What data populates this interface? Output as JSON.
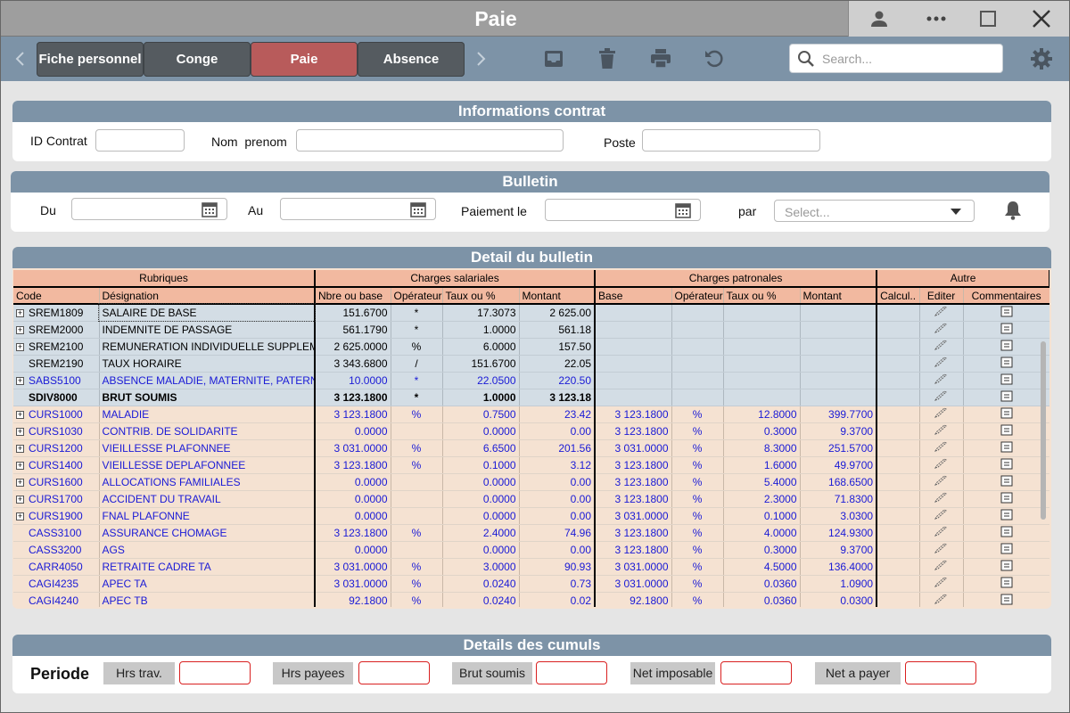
{
  "window": {
    "title": "Paie"
  },
  "tabs": [
    {
      "label": "Fiche personnel",
      "active": false
    },
    {
      "label": "Conge",
      "active": false
    },
    {
      "label": "Paie",
      "active": true
    },
    {
      "label": "Absence",
      "active": false
    }
  ],
  "search": {
    "placeholder": "Search..."
  },
  "contrat": {
    "title": "Informations contrat",
    "id_label": "ID Contrat",
    "nom_label": "Nom  prenom",
    "poste_label": "Poste"
  },
  "bulletin": {
    "title": "Bulletin",
    "du_label": "Du",
    "au_label": "Au",
    "paiement_label": "Paiement le",
    "par_label": "par",
    "par_placeholder": "Select..."
  },
  "detail": {
    "title": "Detail du bulletin",
    "groups": [
      "Rubriques",
      "Charges salariales",
      "Charges patronales",
      "Autre"
    ],
    "columns": [
      "Code",
      "Désignation",
      "Nbre ou base",
      "Opérateur",
      "Taux ou %",
      "Montant",
      "Base",
      "Opérateur",
      "Taux ou %",
      "Montant",
      "Calcul..",
      "Editer",
      "Commentaires"
    ],
    "rows": [
      {
        "exp": true,
        "style": "grey",
        "code": "SREM1809",
        "des": "SALAIRE DE BASE",
        "nb": "151.6700",
        "op": "*",
        "taux": "17.3073",
        "mt": "2 625.00",
        "pb": "",
        "pop": "",
        "ptaux": "",
        "pmt": ""
      },
      {
        "exp": true,
        "style": "grey",
        "code": "SREM2000",
        "des": "INDEMNITE DE PASSAGE",
        "nb": "561.1790",
        "op": "*",
        "taux": "1.0000",
        "mt": "561.18",
        "pb": "",
        "pop": "",
        "ptaux": "",
        "pmt": ""
      },
      {
        "exp": true,
        "style": "grey",
        "code": "SREM2100",
        "des": "REMUNERATION INDIVIDUELLE SUPPLEMENTAIRE",
        "nb": "2 625.0000",
        "op": "%",
        "taux": "6.0000",
        "mt": "157.50",
        "pb": "",
        "pop": "",
        "ptaux": "",
        "pmt": ""
      },
      {
        "exp": false,
        "style": "grey",
        "code": "SREM2190",
        "des": "TAUX HORAIRE",
        "nb": "3 343.6800",
        "op": "/",
        "taux": "151.6700",
        "mt": "22.05",
        "pb": "",
        "pop": "",
        "ptaux": "",
        "pmt": ""
      },
      {
        "exp": true,
        "style": "grey blue",
        "code": "SABS5100",
        "des": "ABSENCE MALADIE, MATERNITE, PATERNITE",
        "nb": "10.0000",
        "op": "*",
        "taux": "22.0500",
        "mt": "220.50",
        "pb": "",
        "pop": "",
        "ptaux": "",
        "pmt": ""
      },
      {
        "exp": false,
        "style": "grey bold",
        "code": "SDIV8000",
        "des": "BRUT SOUMIS",
        "nb": "3 123.1800",
        "op": "*",
        "taux": "1.0000",
        "mt": "3 123.18",
        "pb": "",
        "pop": "",
        "ptaux": "",
        "pmt": ""
      },
      {
        "exp": true,
        "style": "peach blue",
        "code": "CURS1000",
        "des": "MALADIE",
        "nb": "3 123.1800",
        "op": "%",
        "taux": "0.7500",
        "mt": "23.42",
        "pb": "3 123.1800",
        "pop": "%",
        "ptaux": "12.8000",
        "pmt": "399.7700"
      },
      {
        "exp": true,
        "style": "peach blue",
        "code": "CURS1030",
        "des": "CONTRIB. DE SOLIDARITE",
        "nb": "0.0000",
        "op": "",
        "taux": "0.0000",
        "mt": "0.00",
        "pb": "3 123.1800",
        "pop": "%",
        "ptaux": "0.3000",
        "pmt": "9.3700"
      },
      {
        "exp": true,
        "style": "peach blue",
        "code": "CURS1200",
        "des": "VIEILLESSE PLAFONNEE",
        "nb": "3 031.0000",
        "op": "%",
        "taux": "6.6500",
        "mt": "201.56",
        "pb": "3 031.0000",
        "pop": "%",
        "ptaux": "8.3000",
        "pmt": "251.5700"
      },
      {
        "exp": true,
        "style": "peach blue",
        "code": "CURS1400",
        "des": "VIEILLESSE DEPLAFONNEE",
        "nb": "3 123.1800",
        "op": "%",
        "taux": "0.1000",
        "mt": "3.12",
        "pb": "3 123.1800",
        "pop": "%",
        "ptaux": "1.6000",
        "pmt": "49.9700"
      },
      {
        "exp": true,
        "style": "peach blue",
        "code": "CURS1600",
        "des": "ALLOCATIONS FAMILIALES",
        "nb": "0.0000",
        "op": "",
        "taux": "0.0000",
        "mt": "0.00",
        "pb": "3 123.1800",
        "pop": "%",
        "ptaux": "5.4000",
        "pmt": "168.6500"
      },
      {
        "exp": true,
        "style": "peach blue",
        "code": "CURS1700",
        "des": "ACCIDENT DU TRAVAIL",
        "nb": "0.0000",
        "op": "",
        "taux": "0.0000",
        "mt": "0.00",
        "pb": "3 123.1800",
        "pop": "%",
        "ptaux": "2.3000",
        "pmt": "71.8300"
      },
      {
        "exp": true,
        "style": "peach blue",
        "code": "CURS1900",
        "des": "FNAL PLAFONNE",
        "nb": "0.0000",
        "op": "",
        "taux": "0.0000",
        "mt": "0.00",
        "pb": "3 031.0000",
        "pop": "%",
        "ptaux": "0.1000",
        "pmt": "3.0300"
      },
      {
        "exp": false,
        "style": "peach blue",
        "code": "CASS3100",
        "des": "ASSURANCE CHOMAGE",
        "nb": "3 123.1800",
        "op": "%",
        "taux": "2.4000",
        "mt": "74.96",
        "pb": "3 123.1800",
        "pop": "%",
        "ptaux": "4.0000",
        "pmt": "124.9300"
      },
      {
        "exp": false,
        "style": "peach blue",
        "code": "CASS3200",
        "des": "AGS",
        "nb": "0.0000",
        "op": "",
        "taux": "0.0000",
        "mt": "0.00",
        "pb": "3 123.1800",
        "pop": "%",
        "ptaux": "0.3000",
        "pmt": "9.3700"
      },
      {
        "exp": false,
        "style": "peach blue",
        "code": "CARR4050",
        "des": "RETRAITE CADRE TA",
        "nb": "3 031.0000",
        "op": "%",
        "taux": "3.0000",
        "mt": "90.93",
        "pb": "3 031.0000",
        "pop": "%",
        "ptaux": "4.5000",
        "pmt": "136.4000"
      },
      {
        "exp": false,
        "style": "peach blue",
        "code": "CAGI4235",
        "des": "APEC TA",
        "nb": "3 031.0000",
        "op": "%",
        "taux": "0.0240",
        "mt": "0.73",
        "pb": "3 031.0000",
        "pop": "%",
        "ptaux": "0.0360",
        "pmt": "1.0900"
      },
      {
        "exp": false,
        "style": "peach blue",
        "code": "CAGI4240",
        "des": "APEC TB",
        "nb": "92.1800",
        "op": "%",
        "taux": "0.0240",
        "mt": "0.02",
        "pb": "92.1800",
        "pop": "%",
        "ptaux": "0.0360",
        "pmt": "0.0300"
      }
    ]
  },
  "cumuls": {
    "title": "Details des cumuls",
    "periode_label": "Periode",
    "items": [
      "Hrs trav.",
      "Hrs payees",
      "Brut soumis",
      "Net imposable",
      "Net a payer"
    ]
  }
}
